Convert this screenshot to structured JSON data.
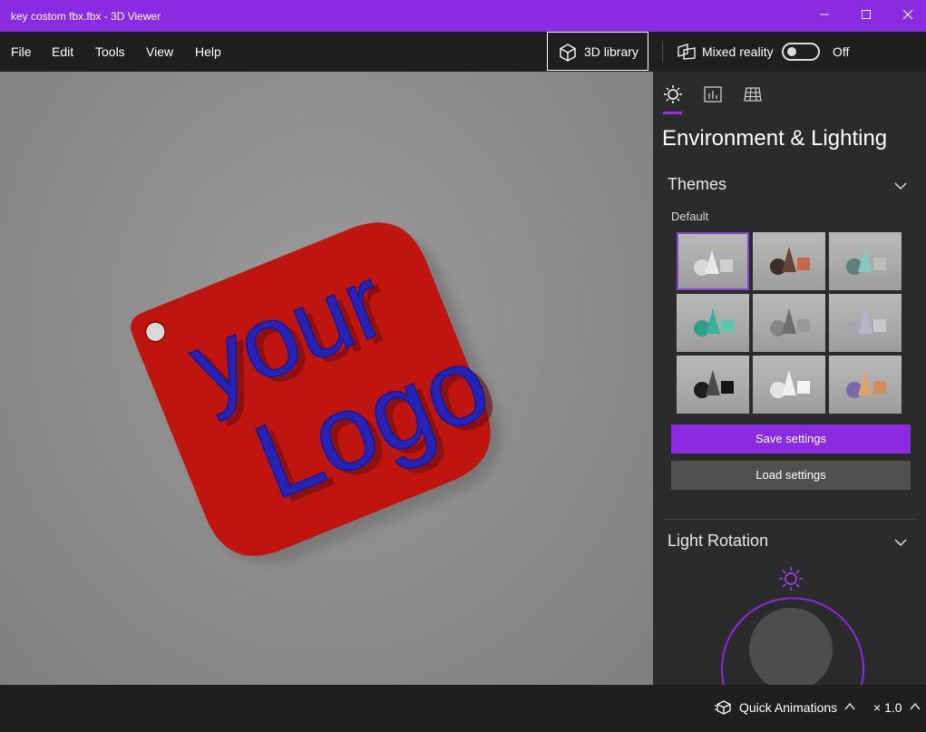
{
  "window": {
    "title": "key costom fbx.fbx - 3D Viewer"
  },
  "menu": {
    "items": [
      "File",
      "Edit",
      "Tools",
      "View",
      "Help"
    ]
  },
  "toolbar": {
    "library_label": "3D library",
    "mixed_reality_label": "Mixed reality",
    "mixed_reality_state": "Off"
  },
  "model": {
    "line1": "your",
    "line2": "Logo"
  },
  "panel": {
    "title": "Environment & Lighting",
    "themes_title": "Themes",
    "default_label": "Default",
    "save_label": "Save settings",
    "load_label": "Load settings",
    "light_rotation_title": "Light Rotation"
  },
  "status": {
    "quick_animations_label": "Quick Animations",
    "speed_label": "× 1.0"
  },
  "colors": {
    "accent": "#8a2be2",
    "model_body": "#c0150f",
    "model_text": "#2020b8"
  }
}
